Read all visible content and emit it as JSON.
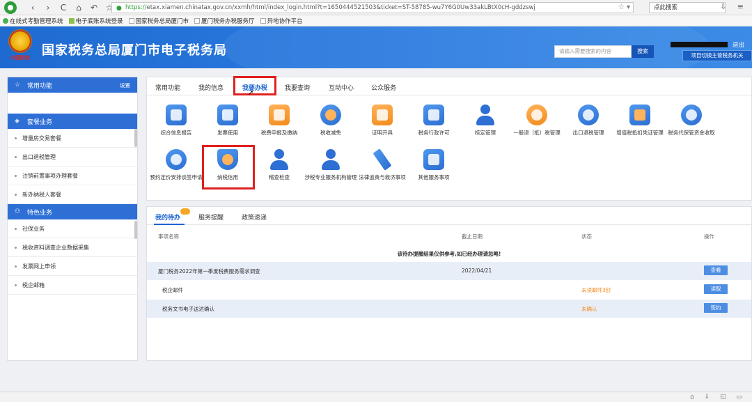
{
  "browser": {
    "nav_back": "‹",
    "nav_forward": "›",
    "nav_reload": "C",
    "nav_home": "⌂",
    "nav_undo": "↶",
    "nav_star": "☆",
    "url_scheme": "https://",
    "url_rest": "etax.xiamen.chinatax.gov.cn/xxmh/html/index_login.html?t=1650444521503&ticket=ST-58785-wu7Y6G0Uw33akLBtX0cH-gddzswj",
    "search_value": "点此搜索",
    "bookmarks": [
      {
        "label": "在线式考勤管理系统",
        "icon": "globe-icon"
      },
      {
        "label": "电子底账系统登录",
        "icon": "leaf-icon"
      },
      {
        "label": "国家税务总局厦门市",
        "icon": "page-icon"
      },
      {
        "label": "厦门税务办税服务厅",
        "icon": "page-icon"
      },
      {
        "label": "异地协作平台",
        "icon": "page-icon"
      }
    ]
  },
  "header": {
    "emblem_text": "中国税务",
    "title": "国家税务总局厦门市电子税务局",
    "search_placeholder": "请输入需要搜索的内容",
    "search_button": "搜索",
    "logout": "退出",
    "switch_button": "项目切换主管税务机关"
  },
  "sidebar": {
    "section1": {
      "title": "常用功能",
      "settings": "设置",
      "icon": "star-icon"
    },
    "section2": {
      "title": "套餐业务",
      "icon": "layers-icon",
      "items": [
        "增量房交易套餐",
        "出口退税管理",
        "注销前置事项办理套餐",
        "新办纳税人套餐"
      ]
    },
    "section3": {
      "title": "特色业务",
      "icon": "people-icon",
      "items": [
        "社保业务",
        "税收资料调查企业数据采集",
        "发票网上申领",
        "税企邮箱"
      ]
    }
  },
  "main": {
    "tabs": [
      "常用功能",
      "我的信息",
      "我要办税",
      "我要查询",
      "互动中心",
      "公众服务"
    ],
    "active_tab": "我要办税",
    "services_row1": [
      {
        "label": "综合信息报告",
        "icon": "report-icon"
      },
      {
        "label": "发票使用",
        "icon": "invoice-icon"
      },
      {
        "label": "税费申报及缴纳",
        "icon": "tax-declare-icon"
      },
      {
        "label": "税收减免",
        "icon": "tax-reduce-icon"
      },
      {
        "label": "证明开具",
        "icon": "certificate-icon"
      },
      {
        "label": "税务行政许可",
        "icon": "license-icon"
      },
      {
        "label": "核定管理",
        "icon": "verify-icon"
      },
      {
        "label": "一般退（抵）税管理",
        "icon": "refund-icon"
      },
      {
        "label": "出口退税管理",
        "icon": "export-refund-icon"
      },
      {
        "label": "增值税抵扣凭证管理",
        "icon": "vat-voucher-icon"
      },
      {
        "label": "税务代保管资金收取",
        "icon": "money-bag-icon"
      }
    ],
    "services_row2": [
      {
        "label": "预约定价安排谈签申请",
        "icon": "compass-icon"
      },
      {
        "label": "纳税信用",
        "icon": "credit-diamond-icon"
      },
      {
        "label": "稽查检查",
        "icon": "inspector-icon"
      },
      {
        "label": "涉税专业服务机构管理",
        "icon": "agency-icon"
      },
      {
        "label": "法律追责与救济事项",
        "icon": "gavel-icon"
      },
      {
        "label": "其他服务事项",
        "icon": "list-icon"
      }
    ]
  },
  "todo": {
    "tabs": [
      "我的待办",
      "服务提醒",
      "政策速递"
    ],
    "active_tab": "我的待办",
    "columns": [
      "事项名称",
      "截止日期",
      "状态",
      "操作"
    ],
    "notice": "该待办提醒结果仅供参考,如已经办理请忽略!",
    "rows": [
      {
        "name": "厦门税务2022年第一季度税费服务需求调查",
        "date": "2022/04/21",
        "status": "",
        "action": "查看"
      },
      {
        "name": "税企邮件",
        "date": "",
        "status": "未读邮件3封",
        "action": "读取"
      },
      {
        "name": "税务文书电子送达确认",
        "date": "",
        "status": "未确认",
        "action": "签约"
      }
    ]
  },
  "statusbar": {
    "icons": "⌂ ⇩ ◱ ▭"
  }
}
